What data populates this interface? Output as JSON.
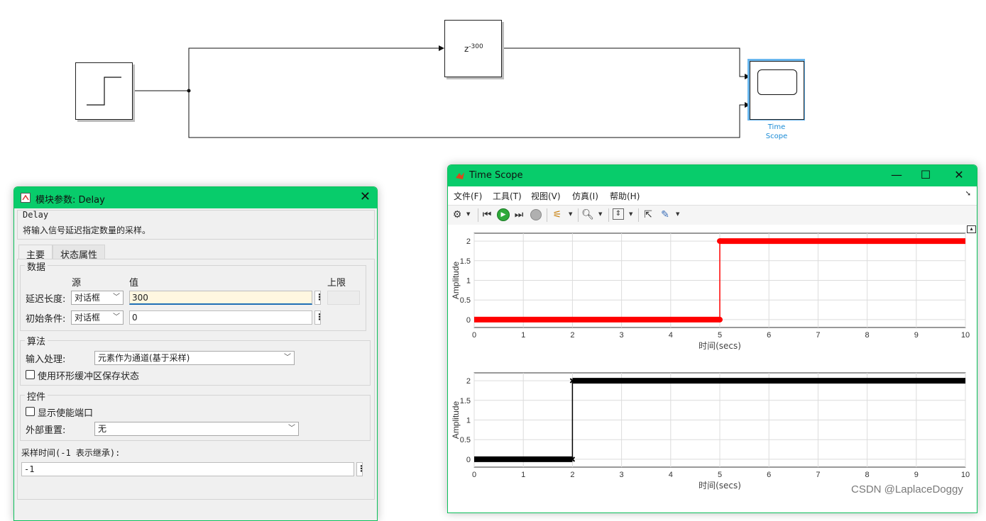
{
  "diagram": {
    "delay_block": {
      "base": "z",
      "exponent": "-300"
    },
    "scope_block": {
      "label_line1": "Time",
      "label_line2": "Scope"
    }
  },
  "dialog": {
    "title": "模块参数: Delay",
    "block_name": "Delay",
    "description": "将输入信号延迟指定数量的采样。",
    "tabs": [
      "主要",
      "状态属性"
    ],
    "data_section": {
      "legend": "数据",
      "col_source": "源",
      "col_value": "值",
      "col_upper": "上限",
      "rows": [
        {
          "label": "延迟长度:",
          "source": "对话框",
          "value": "300"
        },
        {
          "label": "初始条件:",
          "source": "对话框",
          "value": "0"
        }
      ]
    },
    "algorithm": {
      "legend": "算法",
      "input_label": "输入处理:",
      "input_value": "元素作为通道(基于采样)",
      "circular_buffer_label": "使用环形缓冲区保存状态"
    },
    "control": {
      "legend": "控件",
      "enable_port_label": "显示使能端口",
      "reset_label": "外部重置:",
      "reset_value": "无"
    },
    "sample_time_label": "采样时间(-1 表示继承):",
    "sample_time_value": "-1"
  },
  "scope": {
    "title": "Time Scope",
    "menu": [
      "文件(F)",
      "工具(T)",
      "视图(V)",
      "仿真(I)",
      "帮助(H)"
    ],
    "icons": [
      "gear-icon",
      "rewind-icon",
      "run-icon",
      "step-forward-icon",
      "stop-icon",
      "highlight-icon",
      "zoom-icon",
      "scale-icon",
      "pin-icon",
      "measure-icon"
    ]
  },
  "colors": {
    "title_bar": "#08cc6b",
    "signal_delayed": "#ff0000",
    "signal_original": "#000000",
    "link_text": "#1a8bd6"
  },
  "chart_data": [
    {
      "type": "line",
      "xlabel": "时间(secs)",
      "ylabel": "Amplitude",
      "xlim": [
        0,
        10
      ],
      "ylim": [
        -0.2,
        2.2
      ],
      "xticks": [
        0,
        1,
        2,
        3,
        4,
        5,
        6,
        7,
        8,
        9,
        10
      ],
      "yticks": [
        0,
        0.5,
        1,
        1.5,
        2
      ],
      "ytick_labels": [
        "0",
        "0.5",
        "1",
        "1.5",
        "2"
      ],
      "grid": true,
      "series": [
        {
          "color": "#ff0000",
          "x": [
            0,
            5,
            5,
            10
          ],
          "y": [
            0,
            0,
            2,
            2
          ]
        }
      ]
    },
    {
      "type": "line",
      "xlabel": "时间(secs)",
      "ylabel": "Amplitude",
      "xlim": [
        0,
        10
      ],
      "ylim": [
        -0.2,
        2.2
      ],
      "xticks": [
        0,
        1,
        2,
        3,
        4,
        5,
        6,
        7,
        8,
        9,
        10
      ],
      "yticks": [
        0,
        0.5,
        1,
        1.5,
        2
      ],
      "ytick_labels": [
        "0",
        "0.5",
        "1",
        "1.5",
        "2"
      ],
      "grid": true,
      "series": [
        {
          "color": "#000000",
          "x": [
            0,
            2,
            2,
            10
          ],
          "y": [
            0,
            0,
            2,
            2
          ]
        }
      ]
    }
  ],
  "watermark": "CSDN @LaplaceDoggy"
}
